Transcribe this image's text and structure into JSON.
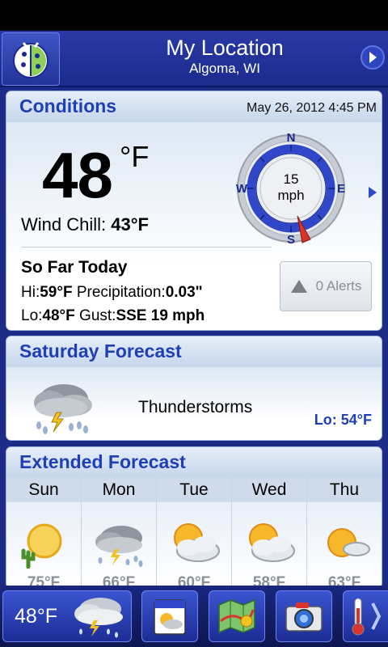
{
  "header": {
    "title": "My Location",
    "subtitle": "Algoma, WI"
  },
  "conditions": {
    "section_title": "Conditions",
    "datetime": "May 26, 2012 4:45 PM",
    "temperature": "48",
    "temperature_unit": "°F",
    "wind_chill_label": "Wind Chill:",
    "wind_chill_value": "43°F",
    "wind_speed": "15",
    "wind_unit": "mph",
    "compass": {
      "n": "N",
      "e": "E",
      "s": "S",
      "w": "W",
      "wind_from": "SSE"
    },
    "so_far_title": "So Far Today",
    "hi_label": "Hi:",
    "hi_value": "59°F",
    "precip_label": "Precipitation:",
    "precip_value": "0.03\"",
    "lo_label": "Lo:",
    "lo_value": "48°F",
    "gust_label": "Gust:",
    "gust_value": "SSE 19 mph",
    "alerts_label": "0 Alerts"
  },
  "saturday": {
    "section_title": "Saturday Forecast",
    "condition": "Thunderstorms",
    "low": "Lo: 54°F",
    "icon": "thunderstorm-icon"
  },
  "extended": {
    "section_title": "Extended Forecast",
    "days": [
      {
        "day": "Sun",
        "icon": "sunny-hot-icon",
        "high": "75°F"
      },
      {
        "day": "Mon",
        "icon": "thunderstorm-icon",
        "high": "66°F"
      },
      {
        "day": "Tue",
        "icon": "partly-cloudy-icon",
        "high": "60°F"
      },
      {
        "day": "Wed",
        "icon": "partly-cloudy-icon",
        "high": "58°F"
      },
      {
        "day": "Thu",
        "icon": "mostly-sunny-icon",
        "high": "63°F"
      }
    ]
  },
  "bottom_bar": {
    "current_temp": "48°F",
    "buttons": [
      "today-forecast",
      "radar-map",
      "camera",
      "thermometer"
    ]
  },
  "colors": {
    "accent": "#1f3fb5",
    "background": "#1d2b86",
    "compass_ring": "#2f47c8",
    "needle": "#d9342b"
  }
}
